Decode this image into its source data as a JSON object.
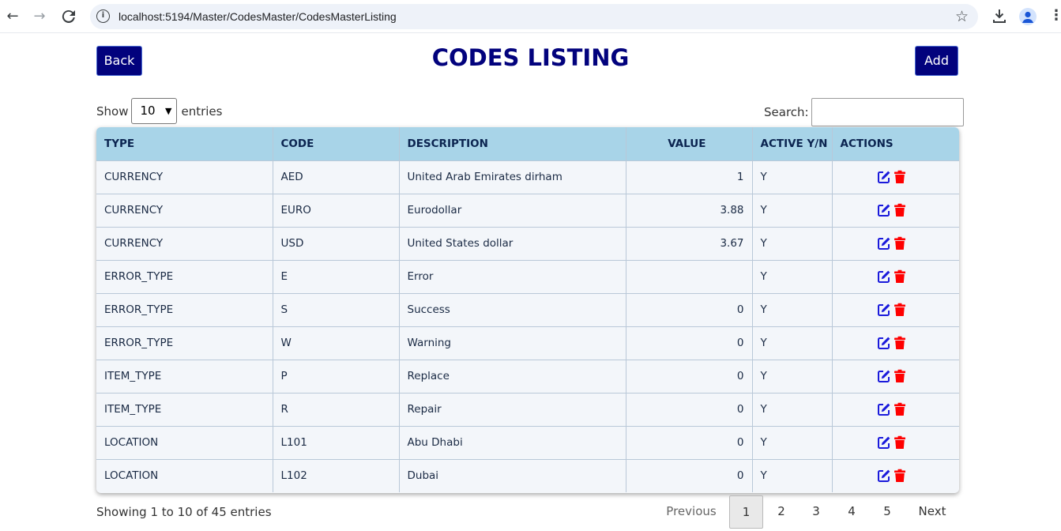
{
  "browser": {
    "url": "localhost:5194/Master/CodesMaster/CodesMasterListing"
  },
  "header": {
    "back_label": "Back",
    "title": "CODES LISTING",
    "add_label": "Add"
  },
  "length": {
    "show_label": "Show",
    "selected": "10",
    "entries_label": "entries"
  },
  "search": {
    "label": "Search:",
    "value": ""
  },
  "table": {
    "columns": [
      "TYPE",
      "CODE",
      "DESCRIPTION",
      "VALUE",
      "ACTIVE Y/N",
      "ACTIONS"
    ],
    "rows": [
      {
        "type": "CURRENCY",
        "code": "AED",
        "description": "United Arab Emirates dirham",
        "value": "1",
        "active": "Y"
      },
      {
        "type": "CURRENCY",
        "code": "EURO",
        "description": "Eurodollar",
        "value": "3.88",
        "active": "Y"
      },
      {
        "type": "CURRENCY",
        "code": "USD",
        "description": "United States dollar",
        "value": "3.67",
        "active": "Y"
      },
      {
        "type": "ERROR_TYPE",
        "code": "E",
        "description": "Error",
        "value": "",
        "active": "Y"
      },
      {
        "type": "ERROR_TYPE",
        "code": "S",
        "description": "Success",
        "value": "0",
        "active": "Y"
      },
      {
        "type": "ERROR_TYPE",
        "code": "W",
        "description": "Warning",
        "value": "0",
        "active": "Y"
      },
      {
        "type": "ITEM_TYPE",
        "code": "P",
        "description": "Replace",
        "value": "0",
        "active": "Y"
      },
      {
        "type": "ITEM_TYPE",
        "code": "R",
        "description": "Repair",
        "value": "0",
        "active": "Y"
      },
      {
        "type": "LOCATION",
        "code": "L101",
        "description": "Abu Dhabi",
        "value": "0",
        "active": "Y"
      },
      {
        "type": "LOCATION",
        "code": "L102",
        "description": "Dubai",
        "value": "0",
        "active": "Y"
      }
    ]
  },
  "footer": {
    "info": "Showing 1 to 10 of 45 entries",
    "previous": "Previous",
    "pages": [
      "1",
      "2",
      "3",
      "4",
      "5"
    ],
    "next": "Next"
  },
  "colors": {
    "brand": "#02027d",
    "header_bg": "#a8d4e8",
    "edit_icon": "#1a1adb",
    "delete_icon": "#ff0000"
  }
}
